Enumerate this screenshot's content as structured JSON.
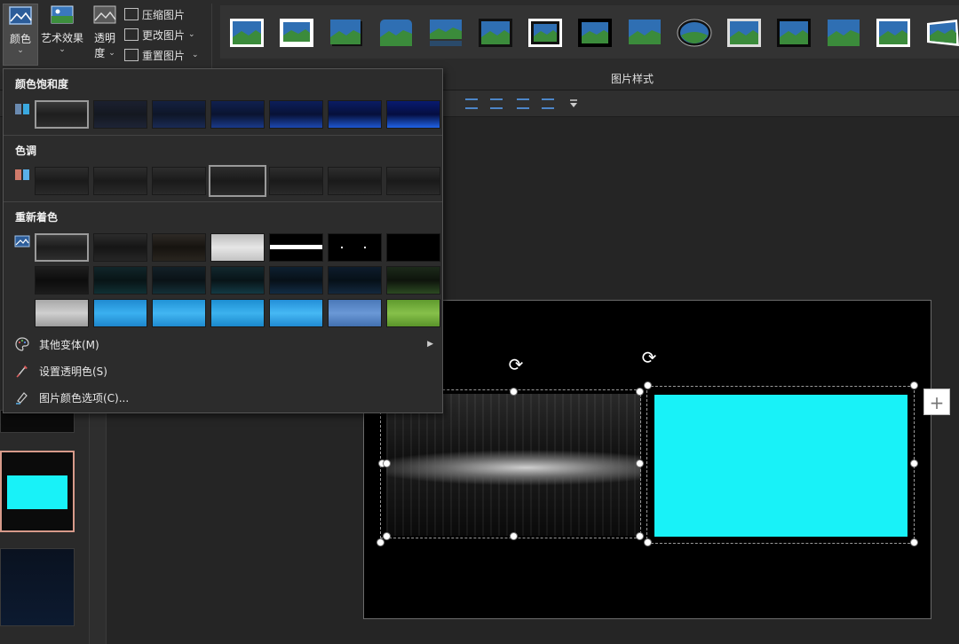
{
  "ribbon": {
    "color_button": {
      "label": "颜色",
      "active": true
    },
    "artistic_effects": {
      "label": "艺术效果"
    },
    "transparency": {
      "label_line1": "透明",
      "label_line2": "度"
    },
    "small_buttons": [
      {
        "label": "压缩图片",
        "icon": "compress-icon"
      },
      {
        "label": "更改图片",
        "icon": "change-picture-icon",
        "caret": true
      },
      {
        "label": "重置图片",
        "icon": "reset-picture-icon",
        "caret": true
      }
    ],
    "gallery_group_label": "图片样式",
    "caret_glyph": "⌄"
  },
  "dropdown": {
    "saturation": {
      "title": "颜色饱和度",
      "selected_index": 0
    },
    "tone": {
      "title": "色调",
      "selected_index": 3
    },
    "recolor": {
      "title": "重新着色",
      "selected_index": 0
    },
    "menu": [
      {
        "label": "其他变体(M)",
        "icon": "palette-icon",
        "submenu": true
      },
      {
        "label": "设置透明色(S)",
        "icon": "transparent-color-icon",
        "submenu": false
      },
      {
        "label": "图片颜色选项(C)...",
        "icon": "picture-color-options-icon",
        "submenu": false
      }
    ],
    "submenu_arrow": "▶"
  },
  "slide": {
    "plus_glyph": "+",
    "rotate_glyph": "⟳",
    "image_right_color": "#18f2f8"
  },
  "colors": {
    "accent": "#4d86c8",
    "cyan": "#18f2f8",
    "selected_thumb_border": "#d79a8a"
  }
}
